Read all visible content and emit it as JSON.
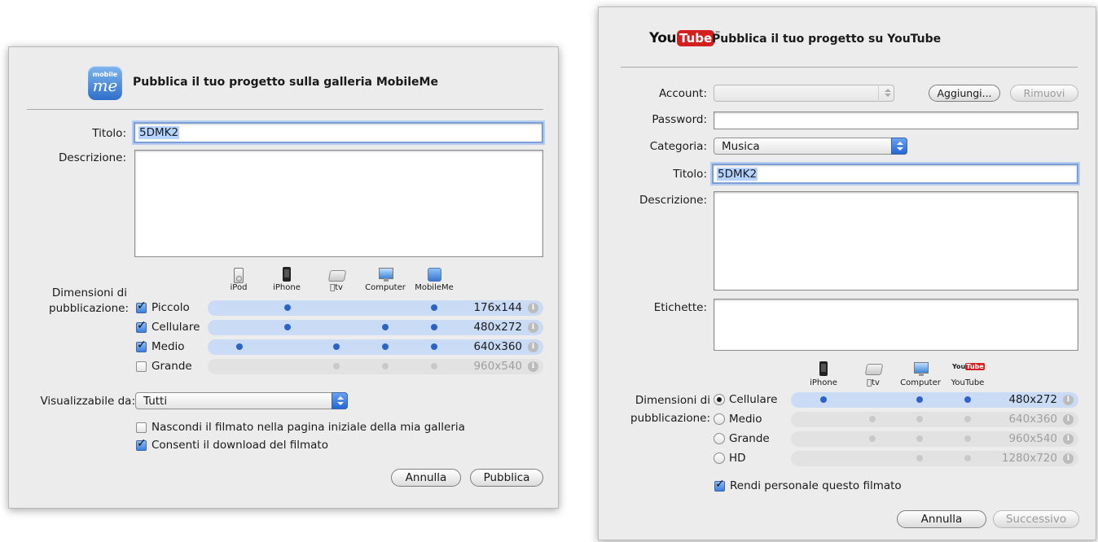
{
  "mobileme": {
    "logo_text_top": "mobile",
    "logo_text_bottom": "me",
    "title": "Pubblica il tuo progetto sulla galleria MobileMe",
    "titolo_label": "Titolo:",
    "titolo_value": "5DMK2",
    "descrizione_label": "Descrizione:",
    "dimensioni_label_1": "Dimensioni di",
    "dimensioni_label_2": "pubblicazione:",
    "devices": [
      "iPod",
      "iPhone",
      "tv",
      "Computer",
      "MobileMe"
    ],
    "rows": [
      {
        "label": "Piccolo",
        "res": "176x144",
        "checked": true,
        "enabled": true,
        "dots": [
          false,
          true,
          false,
          false,
          true
        ]
      },
      {
        "label": "Cellulare",
        "res": "480x272",
        "checked": true,
        "enabled": true,
        "dots": [
          false,
          true,
          false,
          true,
          true
        ]
      },
      {
        "label": "Medio",
        "res": "640x360",
        "checked": true,
        "enabled": true,
        "dots": [
          true,
          false,
          true,
          true,
          true
        ]
      },
      {
        "label": "Grande",
        "res": "960x540",
        "checked": false,
        "enabled": false,
        "dots": [
          false,
          false,
          true,
          true,
          true
        ]
      }
    ],
    "visualizzabile_label": "Visualizzabile da:",
    "visualizzabile_value": "Tutti",
    "nascondi_label": "Nascondi il filmato nella pagina iniziale della mia galleria",
    "nascondi_checked": false,
    "consenti_label": "Consenti il download del filmato",
    "consenti_checked": true,
    "annulla_label": "Annulla",
    "pubblica_label": "Pubblica"
  },
  "youtube": {
    "logo_you": "You",
    "logo_tube": "Tube",
    "logo_tm": "™",
    "title": "Pubblica il tuo progetto su YouTube",
    "account_label": "Account:",
    "account_value": "",
    "aggiungi_label": "Aggiungi...",
    "rimuovi_label": "Rimuovi",
    "password_label": "Password:",
    "categoria_label": "Categoria:",
    "categoria_value": "Musica",
    "titolo_label": "Titolo:",
    "titolo_value": "5DMK2",
    "descrizione_label": "Descrizione:",
    "etichette_label": "Etichette:",
    "dimensioni_label_1": "Dimensioni di",
    "dimensioni_label_2": "pubblicazione:",
    "devices": [
      "iPhone",
      "tv",
      "Computer",
      "YouTube"
    ],
    "rows": [
      {
        "label": "Cellulare",
        "res": "480x272",
        "selected": true,
        "enabled": true,
        "dots": [
          true,
          false,
          true,
          true
        ]
      },
      {
        "label": "Medio",
        "res": "640x360",
        "selected": false,
        "enabled": false,
        "dots": [
          false,
          true,
          true,
          true
        ]
      },
      {
        "label": "Grande",
        "res": "960x540",
        "selected": false,
        "enabled": false,
        "dots": [
          false,
          true,
          true,
          true
        ]
      },
      {
        "label": "HD",
        "res": "1280x720",
        "selected": false,
        "enabled": false,
        "dots": [
          false,
          false,
          true,
          true
        ]
      }
    ],
    "personale_label": "Rendi personale questo filmato",
    "personale_checked": true,
    "annulla_label": "Annulla",
    "successivo_label": "Successivo"
  },
  "colors": {
    "row_on": "#c9dbf5",
    "row_off": "#e2e2e2",
    "dot_on": "#2e63c6",
    "dot_off": "#c9c9c9",
    "youtube_red": "#d3201f"
  }
}
